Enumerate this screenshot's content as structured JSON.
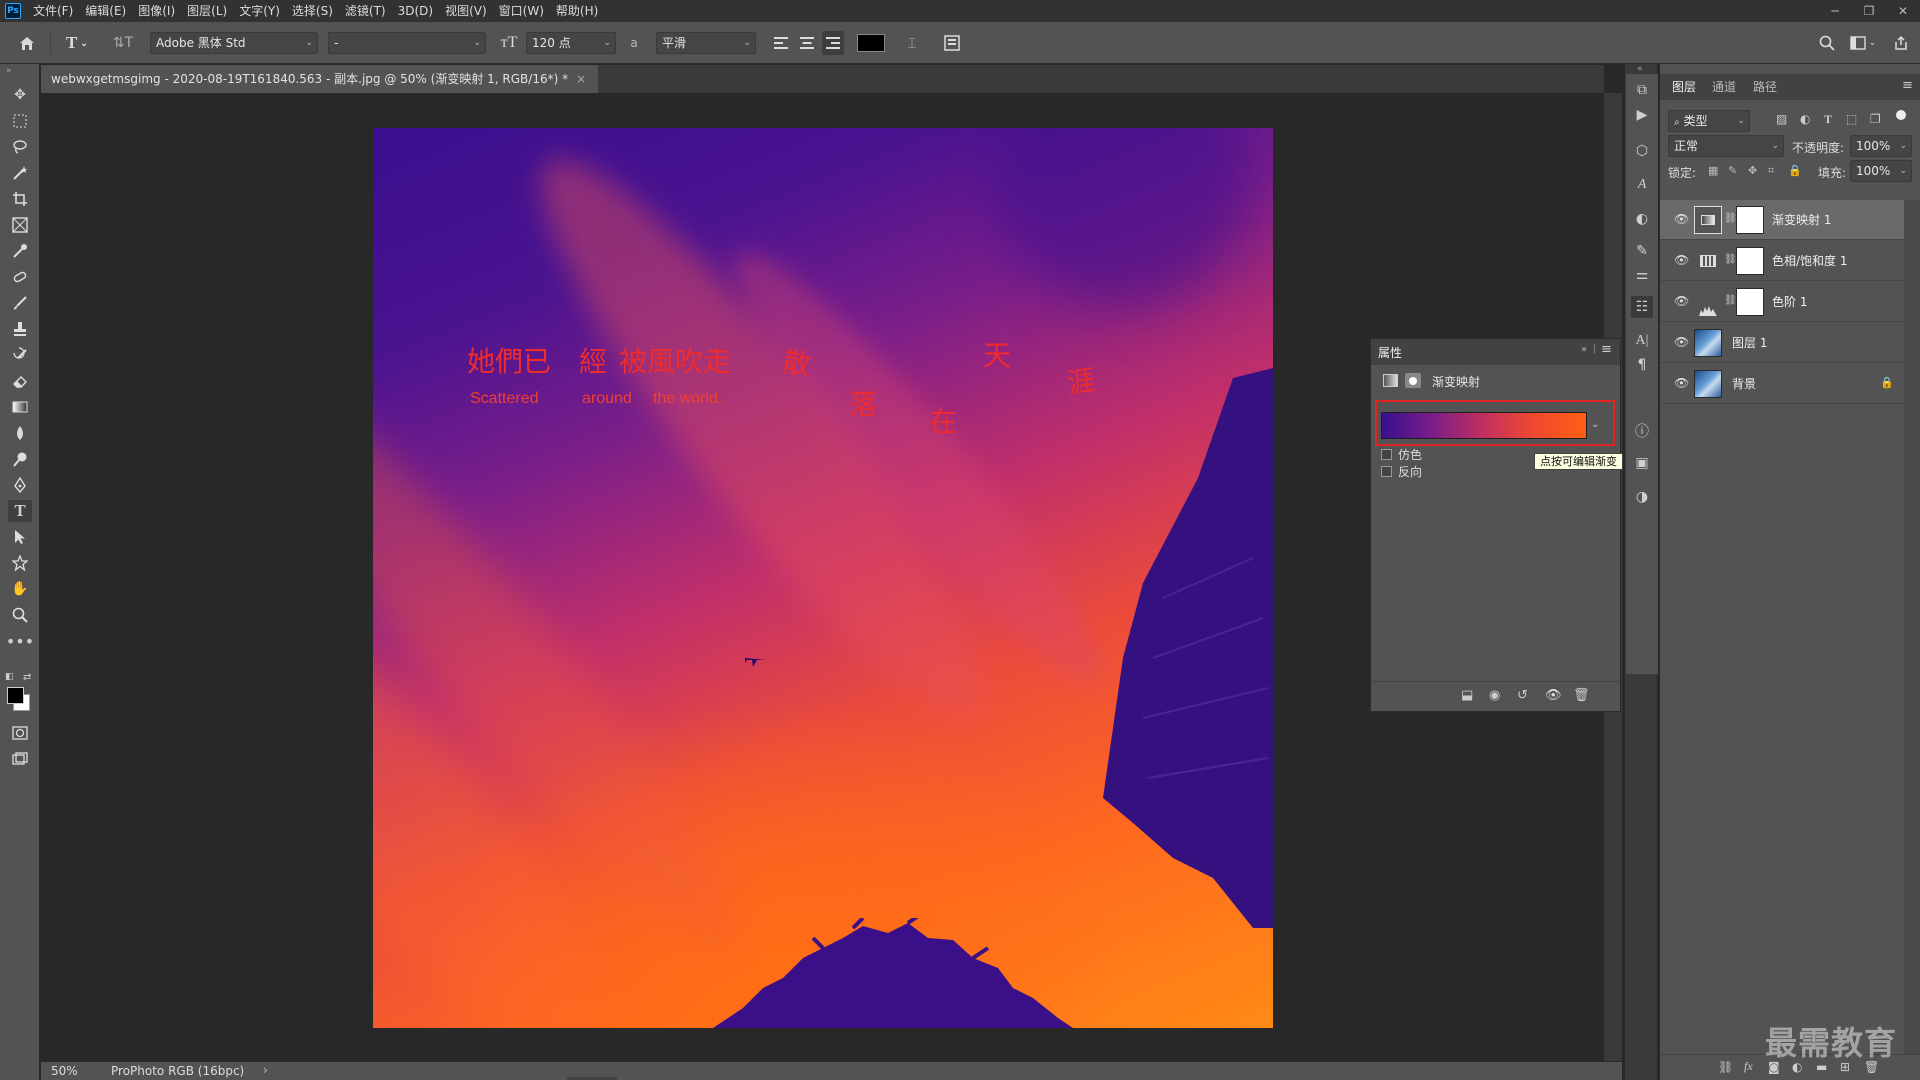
{
  "app": {
    "logo": "Ps",
    "menus": [
      "文件(F)",
      "编辑(E)",
      "图像(I)",
      "图层(L)",
      "文字(Y)",
      "选择(S)",
      "滤镜(T)",
      "3D(D)",
      "视图(V)",
      "窗口(W)",
      "帮助(H)"
    ]
  },
  "options": {
    "font_family": "Adobe 黑体 Std",
    "font_style": "-",
    "font_size": "120 点",
    "antialias_label": "a",
    "antialias": "平滑"
  },
  "document": {
    "tab_title": "webwxgetmsgimg - 2020-08-19T161840.563 - 副本.jpg @ 50% (渐变映射 1, RGB/16*) *",
    "close": "×"
  },
  "artwork": {
    "cn_words": [
      "她們已",
      "經",
      "被風吹走",
      "散",
      "落",
      "在",
      "天",
      "涯"
    ],
    "en_words": [
      "Scattered",
      "around",
      "the world."
    ]
  },
  "status": {
    "zoom": "50%",
    "profile": "ProPhoto RGB (16bpc)",
    "arrow": "›"
  },
  "properties": {
    "title": "属性",
    "adjustment_name": "渐变映射",
    "dither_label": "仿色",
    "reverse_label": "反向",
    "tooltip": "点按可编辑渐变",
    "gradient_colors": [
      "#3a0f90",
      "#7a1e88",
      "#c3305f",
      "#f0492e",
      "#ff5e12"
    ]
  },
  "layers": {
    "tabs": [
      "图层",
      "通道",
      "路径"
    ],
    "filter_kind": "类型",
    "blend_mode": "正常",
    "opacity_label": "不透明度:",
    "opacity": "100%",
    "lock_label": "锁定:",
    "fill_label": "填充:",
    "fill": "100%",
    "items": [
      {
        "name": "渐变映射 1"
      },
      {
        "name": "色相/饱和度 1"
      },
      {
        "name": "色阶 1"
      },
      {
        "name": "图层 1"
      },
      {
        "name": "背景"
      }
    ]
  },
  "watermark": "最需教育"
}
